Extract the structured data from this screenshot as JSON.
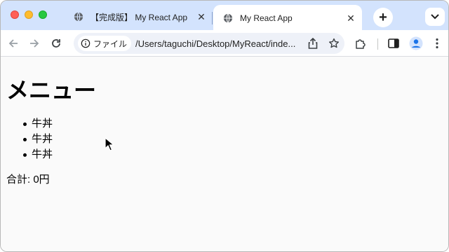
{
  "browser": {
    "tabs": [
      {
        "title": "【完成版】 My React App",
        "active": false
      },
      {
        "title": "My React App",
        "active": true
      }
    ],
    "address_bar": {
      "chip_label": "ファイル",
      "url": "/Users/taguchi/Desktop/MyReact/inde..."
    },
    "icons": {
      "back": "arrow-left-icon",
      "forward": "arrow-right-icon",
      "reload": "reload-icon",
      "info": "info-icon",
      "share": "share-icon",
      "bookmark": "star-icon",
      "extensions": "puzzle-icon",
      "side_panel": "side-panel-icon",
      "profile": "profile-icon",
      "menu": "kebab-menu-icon",
      "new_tab": "plus-icon",
      "tab_search": "chevron-down-icon"
    },
    "colors": {
      "tabstrip": "#d3e3fd",
      "omnibox": "#eef1f8",
      "profile": "#1a73e8"
    }
  },
  "page": {
    "heading": "メニュー",
    "items": [
      "牛丼",
      "牛丼",
      "牛丼"
    ],
    "total_text": "合計: 0円"
  }
}
